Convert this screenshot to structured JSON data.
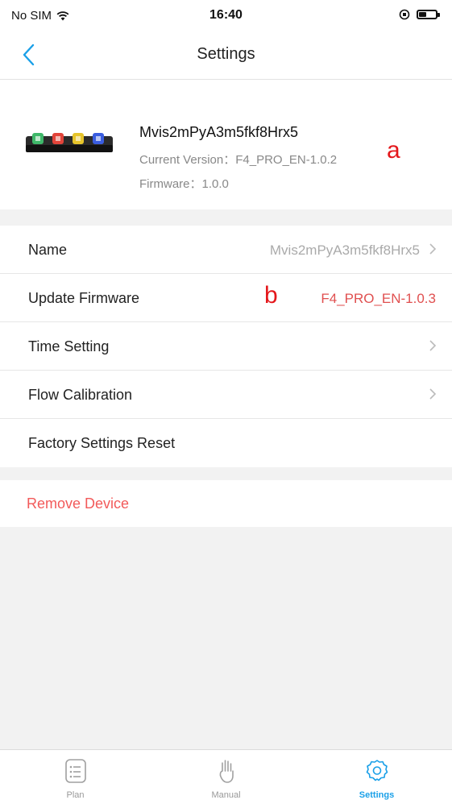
{
  "status_bar": {
    "carrier": "No SIM",
    "time": "16:40",
    "battery_level": 0.45
  },
  "nav": {
    "title": "Settings",
    "back_icon": "chevron-left-icon"
  },
  "device": {
    "name": "Mvis2mPyA3m5fkf8Hrx5",
    "current_version": "Current Version：F4_PRO_EN-1.0.2",
    "firmware": "Firmware：1.0.0",
    "annotation_a": "a"
  },
  "settings": [
    {
      "label": "Name",
      "value": "Mvis2mPyA3m5fkf8Hrx5",
      "chevron": true
    },
    {
      "label": "Update Firmware",
      "value": "F4_PRO_EN-1.0.3",
      "chevron": false,
      "annotation": "b"
    },
    {
      "label": "Time Setting",
      "value": "",
      "chevron": true
    },
    {
      "label": "Flow Calibration",
      "value": "",
      "chevron": true
    },
    {
      "label": "Factory Settings Reset",
      "value": "",
      "chevron": false
    }
  ],
  "remove_device": {
    "label": "Remove Device"
  },
  "tabs": [
    {
      "label": "Plan",
      "icon": "list-icon",
      "active": false
    },
    {
      "label": "Manual",
      "icon": "hand-icon",
      "active": false
    },
    {
      "label": "Settings",
      "icon": "gear-icon",
      "active": true
    }
  ],
  "colors": {
    "accent": "#1aa0e8",
    "danger": "#f25a5a",
    "annotation": "#e4171b"
  }
}
